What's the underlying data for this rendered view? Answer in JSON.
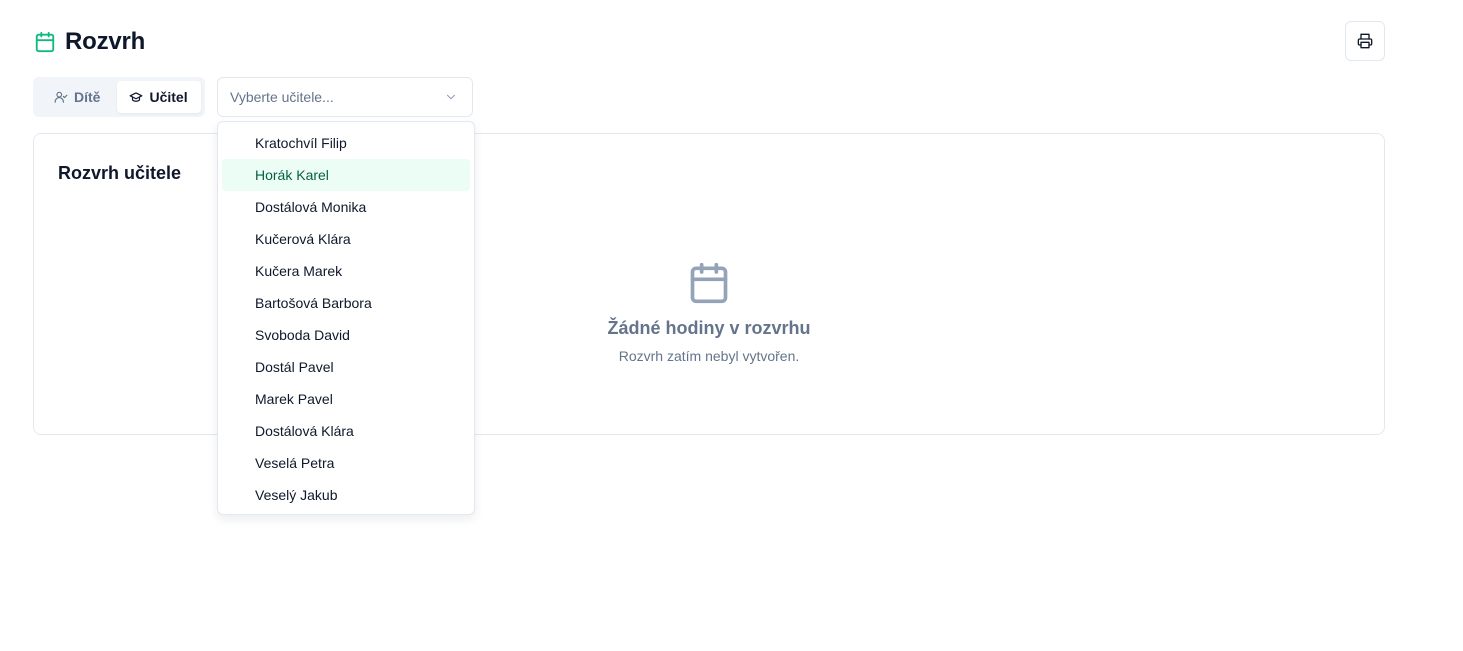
{
  "header": {
    "title": "Rozvrh",
    "title_icon": "calendar-icon",
    "print_icon": "printer-icon"
  },
  "mode_toggle": {
    "child_label": "Dítě",
    "teacher_label": "Učitel",
    "selected": "Učitel"
  },
  "teacher_select": {
    "placeholder": "Vyberte učitele..."
  },
  "card": {
    "title": "Rozvrh učitele",
    "empty_title": "Žádné hodiny v rozvrhu",
    "empty_subtitle": "Rozvrh zatím nebyl vytvořen."
  },
  "dropdown": {
    "highlighted": "Horák Karel",
    "items": [
      "Kratochvíl Filip",
      "Horák Karel",
      "Dostálová Monika",
      "Kučerová Klára",
      "Kučera Marek",
      "Bartošová Barbora",
      "Svoboda David",
      "Dostál Pavel",
      "Marek Pavel",
      "Dostálová Klára",
      "Veselá Petra",
      "Veselý Jakub"
    ]
  },
  "colors": {
    "accent": "#10b981",
    "highlight_bg": "#ecfdf5",
    "highlight_text": "#065f46",
    "muted": "#64748b",
    "border": "#e2e8f0"
  }
}
